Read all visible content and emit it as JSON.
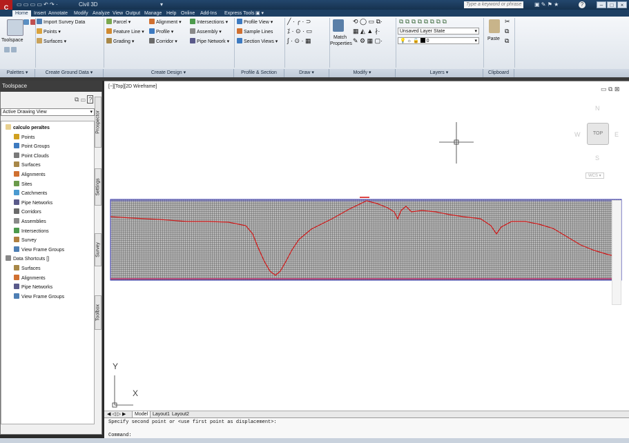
{
  "titlebar": {
    "workspace": "Civil 3D",
    "search_placeholder": "Type a keyword or phrase"
  },
  "tabs": [
    "Home",
    "Insert",
    "Annotate",
    "Modify",
    "Analyze",
    "View",
    "Output",
    "Manage",
    "Help",
    "Online",
    "Add-Ins",
    "Express Tools"
  ],
  "ribbon": {
    "toolspace_label": "Toolspace",
    "import_survey": "Import Survey Data",
    "points": "Points",
    "surfaces": "Surfaces",
    "parcel": "Parcel",
    "feature_line": "Feature Line",
    "grading": "Grading",
    "alignment": "Alignment",
    "profile": "Profile",
    "corridor": "Corridor",
    "intersections": "Intersections",
    "assembly": "Assembly",
    "pipe_network": "Pipe Network",
    "profile_view": "Profile View",
    "sample_lines": "Sample Lines",
    "section_views": "Section Views",
    "match": "Match",
    "properties": "Properties",
    "layer_state": "Unsaved Layer State",
    "layer_current": "0",
    "paste": "Paste",
    "panels": {
      "palettes": "Palettes",
      "create_ground": "Create Ground Data",
      "create_design": "Create Design",
      "profile_section": "Profile & Section Views",
      "draw": "Draw",
      "modify": "Modify",
      "layers": "Layers",
      "clipboard": "Clipboard"
    }
  },
  "toolspace": {
    "title": "Toolspace",
    "dropdown": "Active Drawing View",
    "side_tabs": [
      "Prospector",
      "Settings",
      "Survey",
      "Toolbox"
    ],
    "tree": [
      {
        "label": "calculo peraltes",
        "level": 0,
        "bold": true
      },
      {
        "label": "Points",
        "level": 1
      },
      {
        "label": "Point Groups",
        "level": 1
      },
      {
        "label": "Point Clouds",
        "level": 1
      },
      {
        "label": "Surfaces",
        "level": 1
      },
      {
        "label": "Alignments",
        "level": 1
      },
      {
        "label": "Sites",
        "level": 1
      },
      {
        "label": "Catchments",
        "level": 1
      },
      {
        "label": "Pipe Networks",
        "level": 1
      },
      {
        "label": "Corridors",
        "level": 1
      },
      {
        "label": "Assemblies",
        "level": 1
      },
      {
        "label": "Intersections",
        "level": 1
      },
      {
        "label": "Survey",
        "level": 1
      },
      {
        "label": "View Frame Groups",
        "level": 1
      },
      {
        "label": "Data Shortcuts []",
        "level": 0
      },
      {
        "label": "Surfaces",
        "level": 1
      },
      {
        "label": "Alignments",
        "level": 1
      },
      {
        "label": "Pipe Networks",
        "level": 1
      },
      {
        "label": "View Frame Groups",
        "level": 1
      }
    ]
  },
  "viewport": {
    "label": "[−][Top][2D Wireframe]",
    "viewcube": {
      "top": "TOP",
      "n": "N",
      "s": "S",
      "e": "E",
      "w": "W",
      "wcs": "WCS"
    },
    "ucs_x": "X",
    "ucs_y": "Y"
  },
  "model_tabs": [
    "Model",
    "Layout1",
    "Layout2"
  ],
  "command": {
    "history": "Specify second point or <use first point as displacement>:",
    "prompt": "Command:"
  }
}
